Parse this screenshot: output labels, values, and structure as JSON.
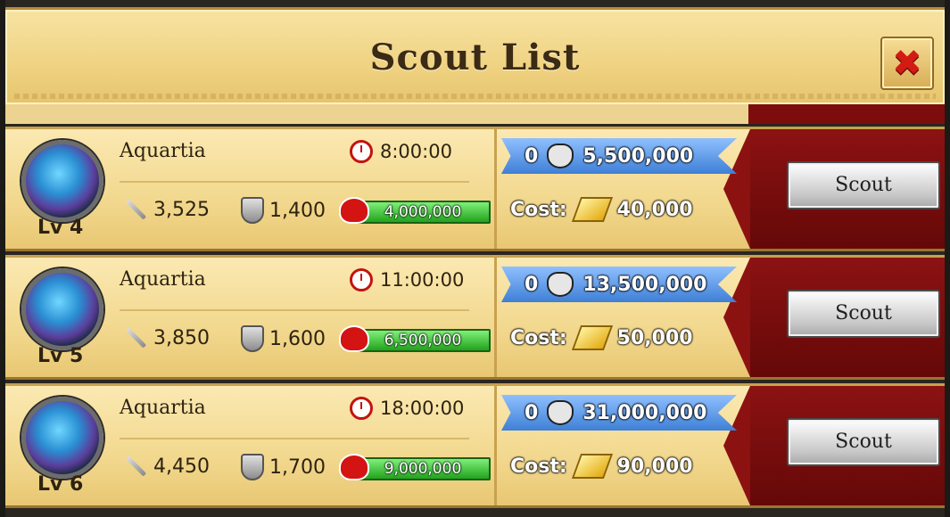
{
  "header": {
    "title": "Scout List",
    "close_icon": "close-icon"
  },
  "rows": [
    {
      "name": "Aquartia",
      "level": "Lv 4",
      "timer": "8:00:00",
      "attack": "3,525",
      "defense": "1,400",
      "hp": "4,000,000",
      "reward_count": "0",
      "reward": "5,500,000",
      "cost_label": "Cost:",
      "cost": "40,000",
      "button": "Scout"
    },
    {
      "name": "Aquartia",
      "level": "Lv 5",
      "timer": "11:00:00",
      "attack": "3,850",
      "defense": "1,600",
      "hp": "6,500,000",
      "reward_count": "0",
      "reward": "13,500,000",
      "cost_label": "Cost:",
      "cost": "50,000",
      "button": "Scout"
    },
    {
      "name": "Aquartia",
      "level": "Lv 6",
      "timer": "18:00:00",
      "attack": "4,450",
      "defense": "1,700",
      "hp": "9,000,000",
      "reward_count": "0",
      "reward": "31,000,000",
      "cost_label": "Cost:",
      "cost": "90,000",
      "button": "Scout"
    }
  ],
  "colors": {
    "panel": "#f2d88e",
    "dark_panel": "#7d0d0d",
    "reward_banner": "#4a86dc",
    "hp_bar": "#2fb02a"
  }
}
